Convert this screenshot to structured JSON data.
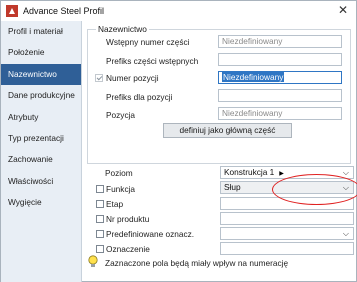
{
  "window": {
    "title": "Advance Steel  Profil"
  },
  "sidebar": {
    "items": [
      {
        "label": "Profil i materiał"
      },
      {
        "label": "Położenie"
      },
      {
        "label": "Nazewnictwo"
      },
      {
        "label": "Dane produkcyjne"
      },
      {
        "label": "Atrybuty"
      },
      {
        "label": "Typ prezentacji"
      },
      {
        "label": "Zachowanie"
      },
      {
        "label": "Właściwości"
      },
      {
        "label": "Wygięcie"
      }
    ],
    "active_index": 2
  },
  "naming_group": {
    "title": "Nazewnictwo",
    "rows": [
      {
        "label": "Wstępny numer części",
        "value": "Niezdefiniowany"
      },
      {
        "label": "Prefiks części wstępnych",
        "value": ""
      },
      {
        "label": "Numer pozycji",
        "value": "Niezdefiniowany"
      },
      {
        "label": "Prefiks dla pozycji",
        "value": ""
      },
      {
        "label": "Pozycja",
        "value": "Niezdefiniowany"
      }
    ],
    "main_part_button": "definiuj jako główną część"
  },
  "lower": {
    "poziom": {
      "label": "Poziom",
      "value": "Konstrukcja 1"
    },
    "funkcja": {
      "label": "Funkcja",
      "value": "Słup"
    },
    "etap": {
      "label": "Etap",
      "value": ""
    },
    "nr_produktu": {
      "label": "Nr produktu",
      "value": ""
    },
    "predefiniowane": {
      "label": "Predefiniowane oznacz.",
      "value": ""
    },
    "oznaczenie": {
      "label": "Oznaczenie",
      "value": ""
    }
  },
  "note": {
    "text": "Zaznaczone pola będą miały wpływ na numerację"
  },
  "colors": {
    "active_sidebar": "#2f5f97",
    "highlight_oval": "#e02222",
    "selection": "#2f76c4"
  }
}
